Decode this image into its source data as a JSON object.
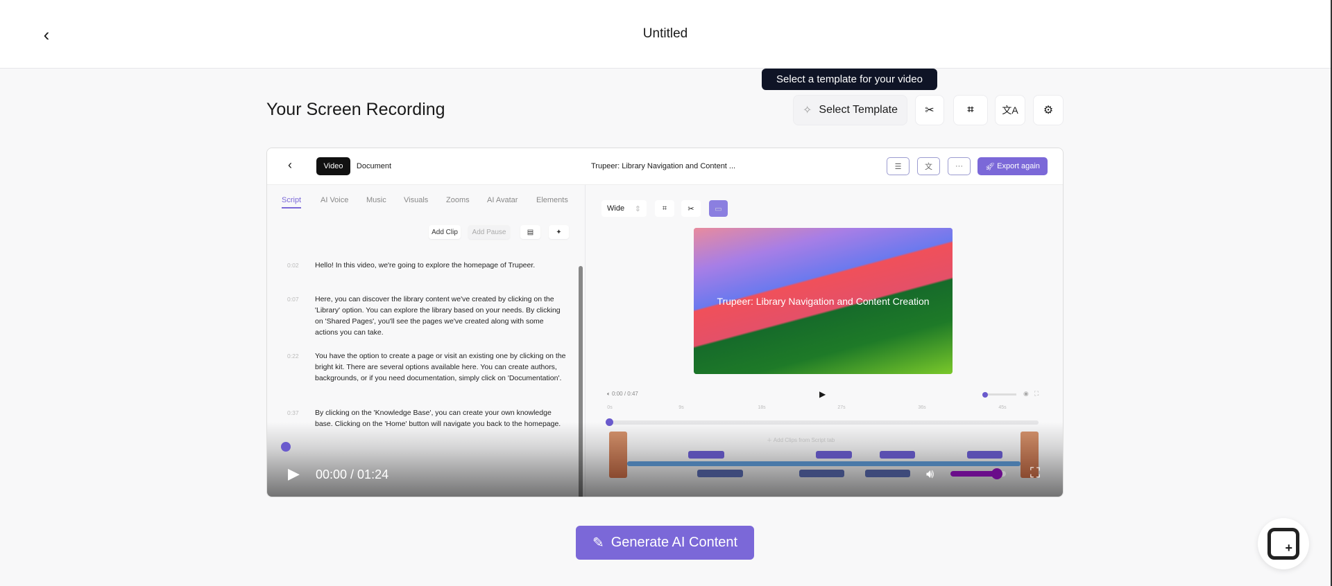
{
  "header": {
    "title": "Untitled"
  },
  "tooltip": "Select a template for your video",
  "page": {
    "heading": "Your Screen Recording"
  },
  "toolbar": {
    "select_template": "Select Template"
  },
  "recording": {
    "mode_tabs": [
      "Video",
      "Document"
    ],
    "project_title": "Trupeer: Library Navigation and Content ...",
    "export_label": "Export again",
    "editor_tabs": [
      "Script",
      "AI Voice",
      "Music",
      "Visuals",
      "Zooms",
      "AI Avatar",
      "Elements"
    ],
    "add_clip": "Add Clip",
    "add_pause": "Add Pause",
    "script": [
      {
        "time": "0:02",
        "text": "Hello! In this video, we're going to explore the homepage of Trupeer."
      },
      {
        "time": "0:07",
        "text": "Here, you can discover the library content we've created by clicking on the 'Library' option. You can explore the library based on your needs. By clicking on 'Shared Pages', you'll see the pages we've created along with some actions you can take."
      },
      {
        "time": "0:22",
        "text": "You have the option to create a page or visit an existing one by clicking on the bright kit. There are several options available here. You can create authors, backgrounds, or if you need documentation, simply click on 'Documentation'."
      },
      {
        "time": "0:37",
        "text": "By clicking on the 'Knowledge Base', you can create your own knowledge base. Clicking on the 'Home' button will navigate you back to the homepage."
      }
    ],
    "aspect": "Wide",
    "preview_title": "Trupeer: Library Navigation and Content Creation",
    "inner_time": "0:00 / 0:47",
    "ticks": [
      "0s",
      "9s",
      "18s",
      "27s",
      "36s",
      "45s"
    ],
    "add_clips_hint": "Add Clips from Script tab",
    "player_time": "00:00 / 01:24",
    "volume_level": 0.85,
    "progress": 0
  },
  "generate": {
    "label": "Generate AI Content"
  },
  "colors": {
    "accent": "#7b68d8",
    "tooltip_bg": "#0f1426"
  }
}
